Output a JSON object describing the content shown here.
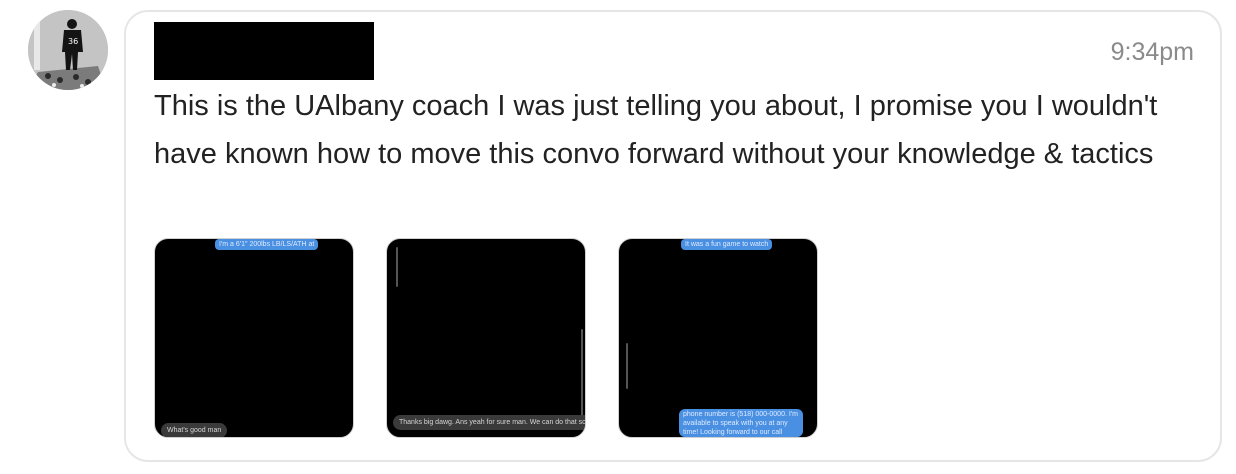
{
  "message": {
    "timestamp": "9:34pm",
    "text": "This is the UAlbany coach I was just telling you about, I promise you I wouldn't have known how to move this convo forward without your knowledge & tactics",
    "attachments": [
      {
        "top_bubble": "I'm a 6'1\" 200lbs LB/LS/ATH at",
        "bottom_bubble": "What's good man"
      },
      {
        "bottom_bubble": "Thanks big dawg. Ans yeah for sure man. We can do that so"
      },
      {
        "top_bubble": "It was a fun game to watch",
        "bottom_bubble": "phone number is (518) 000-0000. I'm available to speak with you at any time! Looking forward to our call"
      }
    ]
  }
}
